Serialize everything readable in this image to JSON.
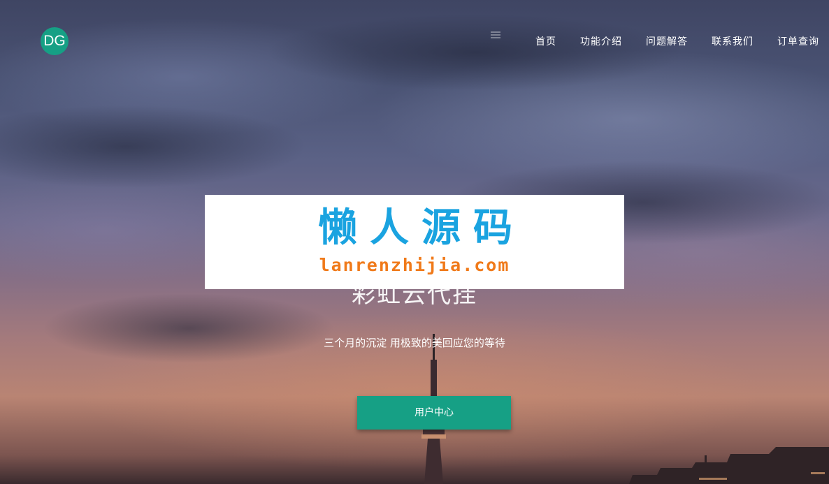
{
  "header": {
    "logo_text": "DG",
    "menu_icon": "hamburger-menu-icon",
    "nav": [
      {
        "label": "首页"
      },
      {
        "label": "功能介绍"
      },
      {
        "label": "问题解答"
      },
      {
        "label": "联系我们"
      },
      {
        "label": "订单查询"
      }
    ]
  },
  "watermark": {
    "title": "懒人源码",
    "url": "lanrenzhijia.com"
  },
  "hero": {
    "title": "彩虹云代挂",
    "subtitle": "三个月的沉淀 用极致的美回应您的等待",
    "button_label": "用户中心"
  },
  "colors": {
    "accent": "#16a085",
    "watermark_title": "#1aa3e0",
    "watermark_url": "#f07a1a"
  }
}
